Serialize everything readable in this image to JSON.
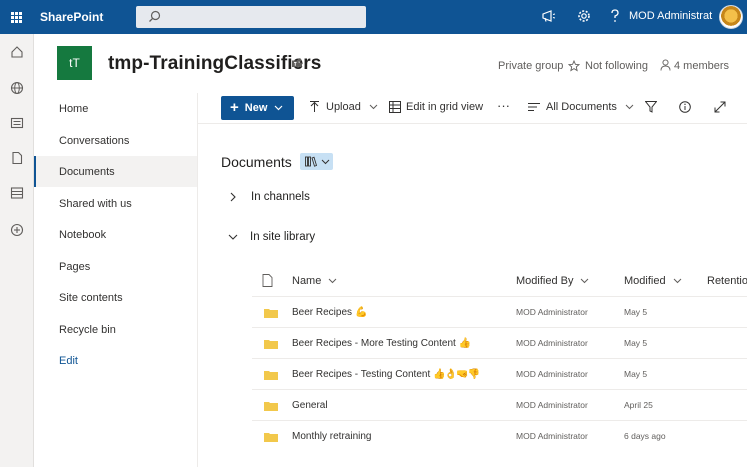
{
  "suite": {
    "brand": "SharePoint",
    "search_placeholder": "",
    "user_name": "MOD Administrat"
  },
  "site": {
    "logo_initials": "tT",
    "title": "tmp-TrainingClassifiers",
    "privacy": "Private group",
    "follow": "Not following",
    "members": "4 members"
  },
  "nav": {
    "items": [
      {
        "label": "Home"
      },
      {
        "label": "Conversations"
      },
      {
        "label": "Documents"
      },
      {
        "label": "Shared with us"
      },
      {
        "label": "Notebook"
      },
      {
        "label": "Pages"
      },
      {
        "label": "Site contents"
      },
      {
        "label": "Recycle bin"
      }
    ],
    "edit_label": "Edit"
  },
  "commands": {
    "new_label": "New",
    "upload_label": "Upload",
    "grid_label": "Edit in grid view",
    "more_label": "···",
    "view_label": "All Documents"
  },
  "library": {
    "title": "Documents",
    "sections": {
      "channels": "In channels",
      "site_library": "In site library"
    },
    "columns": {
      "name": "Name",
      "modified_by": "Modified By",
      "modified": "Modified",
      "retention": "Retentio"
    },
    "rows": [
      {
        "name": "Beer Recipes",
        "emoji": "💪",
        "modified_by": "MOD Administrator",
        "modified": "May 5"
      },
      {
        "name": "Beer Recipes - More Testing Content",
        "emoji": "👍",
        "modified_by": "MOD Administrator",
        "modified": "May 5"
      },
      {
        "name": "Beer Recipes - Testing Content",
        "emoji": "👍👌🤜👎",
        "modified_by": "MOD Administrator",
        "modified": "May 5"
      },
      {
        "name": "General",
        "emoji": "",
        "modified_by": "MOD Administrator",
        "modified": "April 25"
      },
      {
        "name": "Monthly retraining",
        "emoji": "",
        "modified_by": "MOD Administrator",
        "modified": "6 days ago"
      }
    ]
  },
  "colors": {
    "suitebar": "#0f5494",
    "site_logo": "#15793f",
    "folder": "#f2c84b"
  }
}
